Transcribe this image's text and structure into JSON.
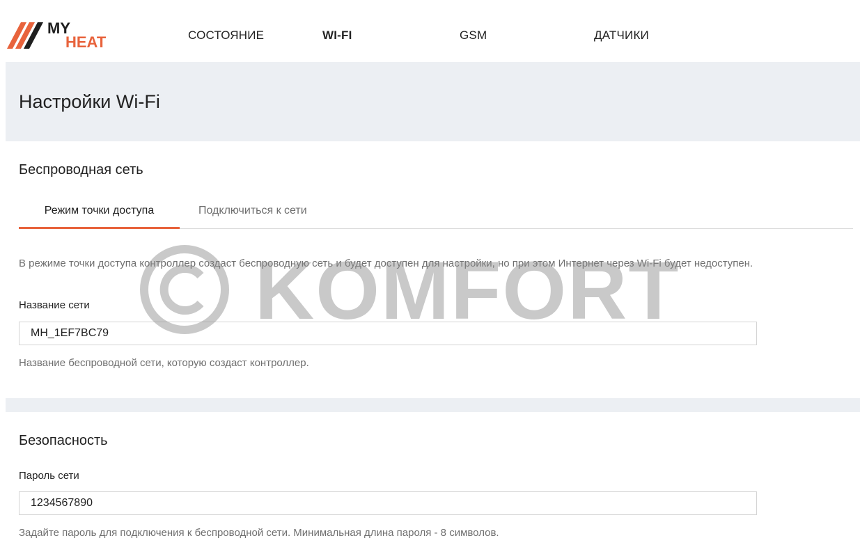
{
  "brand": {
    "logo_text_top": "MY",
    "logo_text_bottom": "HEAT",
    "accent_color": "#e8633c"
  },
  "nav": {
    "items": [
      {
        "label": "СОСТОЯНИЕ",
        "active": false
      },
      {
        "label": "WI-FI",
        "active": true
      },
      {
        "label": "GSM",
        "active": false
      },
      {
        "label": "ДАТЧИКИ",
        "active": false
      }
    ]
  },
  "header": {
    "title": "Настройки Wi-Fi"
  },
  "wireless": {
    "title": "Беспроводная сеть",
    "tabs": [
      {
        "label": "Режим точки доступа",
        "active": true
      },
      {
        "label": "Подключиться к сети",
        "active": false
      }
    ],
    "description": "В режиме точки доступа контроллер создаст беспроводную сеть и будет доступен для настройки, но при этом Интернет через Wi-Fi будет недоступен.",
    "network_name": {
      "label": "Название сети",
      "value": "MH_1EF7BC79",
      "hint": "Название беспроводной сети, которую создаст контроллер."
    }
  },
  "security": {
    "title": "Безопасность",
    "password": {
      "label": "Пароль сети",
      "value": "1234567890",
      "hint": "Задайте пароль для подключения к беспроводной сети. Минимальная длина пароля - 8 символов."
    }
  },
  "watermark": {
    "text": "KOMFORT"
  },
  "icons": {
    "logo": "myheat-logo-icon",
    "watermark": "copyright-icon"
  }
}
